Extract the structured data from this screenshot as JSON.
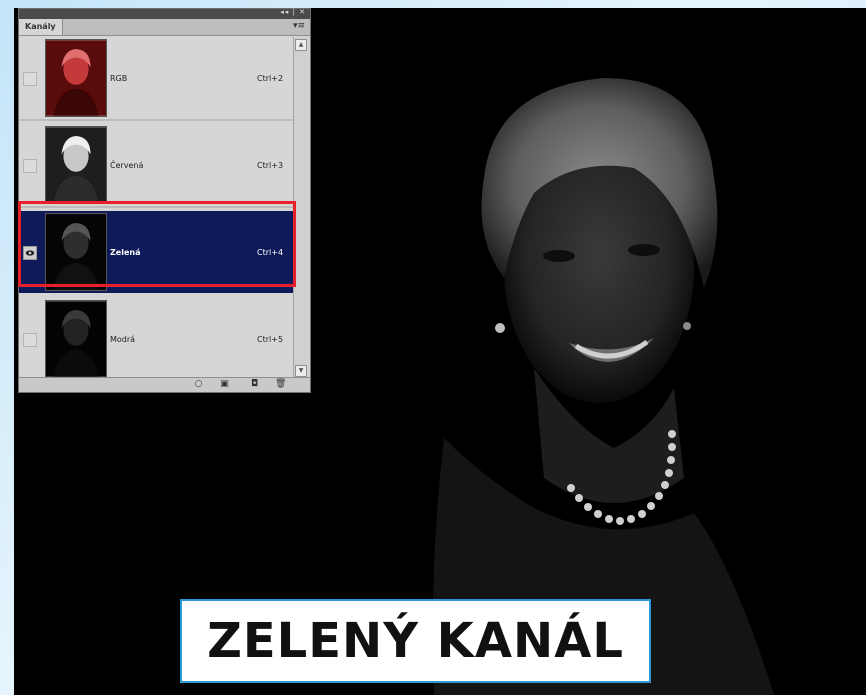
{
  "panel": {
    "title": "Kanály",
    "window_controls": "◂◂ | ✕",
    "menu_icon": "panel-menu-icon",
    "channels": [
      {
        "name": "RGB",
        "shortcut": "Ctrl+2",
        "visible": false,
        "selected": false,
        "tint": "red"
      },
      {
        "name": "Červená",
        "shortcut": "Ctrl+3",
        "visible": false,
        "selected": false,
        "tint": "gray-light"
      },
      {
        "name": "Zelená",
        "shortcut": "Ctrl+4",
        "visible": true,
        "selected": true,
        "tint": "gray-dark"
      },
      {
        "name": "Modrá",
        "shortcut": "Ctrl+5",
        "visible": false,
        "selected": false,
        "tint": "gray-darker"
      }
    ],
    "footer_icons": [
      "load-selection-icon",
      "save-selection-icon",
      "new-channel-icon",
      "delete-channel-icon"
    ]
  },
  "colors": {
    "selected_row": "#0f1a5b",
    "highlight_border": "#e8202a",
    "caption_border": "#2a9ad6"
  },
  "caption": "ZELENÝ KANÁL"
}
